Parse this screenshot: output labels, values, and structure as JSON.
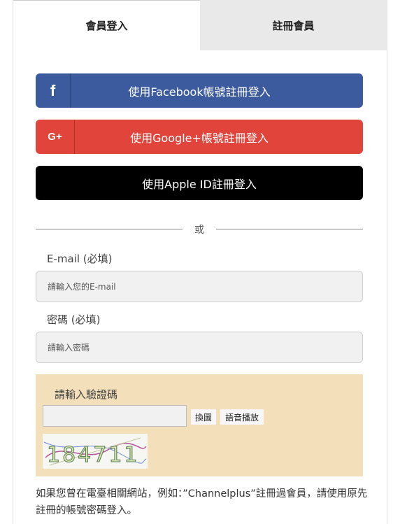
{
  "tabs": {
    "login": "會員登入",
    "register": "註冊會員"
  },
  "social": {
    "facebook": {
      "icon": "f",
      "label": "使用Facebook帳號註冊登入",
      "color": "#3c5a9e"
    },
    "google": {
      "icon": "G+",
      "label": "使用Google+帳號註冊登入",
      "color": "#e0443a"
    },
    "apple": {
      "label": "使用Apple ID註冊登入",
      "color": "#000000"
    }
  },
  "divider": {
    "or": "或"
  },
  "email": {
    "label": "E-mail (必填)",
    "placeholder": "請輸入您的E-mail"
  },
  "password": {
    "label": "密碼 (必填)",
    "placeholder": "請輸入密碼"
  },
  "captcha": {
    "title": "請輸入驗證碼",
    "refresh_label": "換圖",
    "audio_label": "語音播放",
    "code_text": "184711",
    "background": "#f3dfba"
  },
  "note": "如果您曾在電臺相關網站，例如：”Channelplus”註冊過會員，請使用原先註冊的帳號密碼登入。"
}
